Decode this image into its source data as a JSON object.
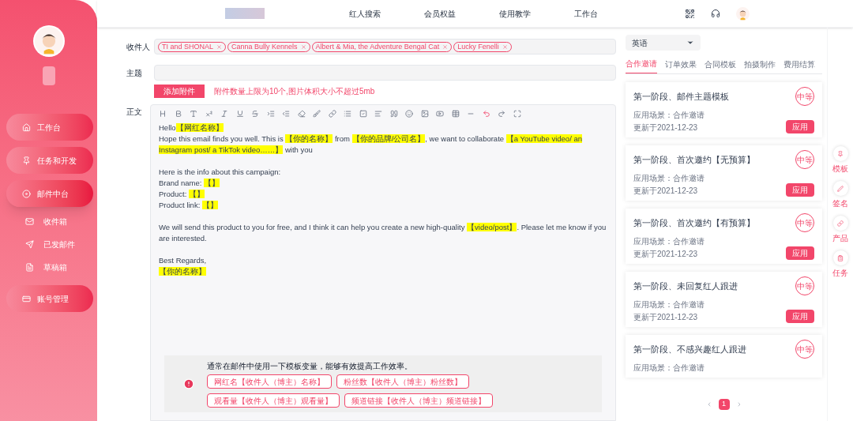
{
  "nav": {
    "items": [
      {
        "label": "红人搜索",
        "selected": false
      },
      {
        "label": "会员权益",
        "selected": false
      },
      {
        "label": "使用教学",
        "selected": false
      },
      {
        "label": "工作台",
        "selected": false
      }
    ]
  },
  "sidebar": {
    "items": [
      {
        "label": "工作台",
        "kind": "main",
        "selected": false
      },
      {
        "label": "任务和开发",
        "kind": "main",
        "selected": false
      },
      {
        "label": "邮件中台",
        "kind": "main",
        "selected": true,
        "expanded": true,
        "children": [
          {
            "label": "收件箱"
          },
          {
            "label": "已发邮件"
          },
          {
            "label": "草稿箱"
          }
        ]
      },
      {
        "label": "账号管理",
        "kind": "main",
        "selected": false
      }
    ]
  },
  "compose": {
    "to_label": "收件人",
    "recipients": [
      "TI and SHONAL",
      "Canna Bully Kennels",
      "Albert & Mia, the Adventure Bengal Cat",
      "Lucky Fenelli"
    ],
    "subject_label": "主题",
    "attach_button": "添加附件",
    "attach_hint": "附件数量上限为10个,图片体积大小不超过5mb",
    "body_label": "正文",
    "body": [
      [
        [
          {
            "text": "Hello",
            "highlight": false
          },
          {
            "text": "【网红名称】",
            "highlight": true
          }
        ],
        [
          {
            "text": "Hope this email finds you well. This is ",
            "highlight": false
          },
          {
            "text": "【你的名称】",
            "highlight": true
          },
          {
            "text": " from ",
            "highlight": false
          },
          {
            "text": "【你的品牌/公司名】",
            "highlight": true
          },
          {
            "text": ", we want to collaborate ",
            "highlight": false
          },
          {
            "text": "【a YouTube video/ an Instagram post/ a TikTok video……】",
            "highlight": true
          },
          {
            "text": " with you",
            "highlight": false
          }
        ]
      ],
      [
        [
          {
            "text": "Here is the info about this campaign:",
            "highlight": false
          }
        ],
        [
          {
            "text": "Brand name: ",
            "highlight": false
          },
          {
            "text": "【】",
            "highlight": true
          }
        ],
        [
          {
            "text": "Product: ",
            "highlight": false
          },
          {
            "text": "【】",
            "highlight": true
          }
        ],
        [
          {
            "text": "Product link: ",
            "highlight": false
          },
          {
            "text": "【】",
            "highlight": true
          }
        ]
      ],
      [
        [
          {
            "text": "We will send this product to you for free, and I think it can help you create a new high-quality ",
            "highlight": false
          },
          {
            "text": "【video/post】",
            "highlight": true
          },
          {
            "text": ". Please let me know if you are interested.",
            "highlight": false
          }
        ]
      ],
      [
        [
          {
            "text": "Best Regards,",
            "highlight": false
          }
        ],
        [
          {
            "text": "【你的名称】",
            "highlight": true
          }
        ]
      ]
    ],
    "tip": "通常在邮件中使用一下模板变量，能够有效提高工作效率。",
    "variables": [
      "网红名【收件人（博主）名称】",
      "粉丝数【收件人（博主）粉丝数】",
      "观看量【收件人（博主）观看量】",
      "频道链接【收件人（博主）频道链接】"
    ]
  },
  "templates": {
    "language": "英语",
    "tabs": [
      {
        "label": "合作邀请",
        "selected": true
      },
      {
        "label": "订单效果",
        "selected": false
      },
      {
        "label": "合同模板",
        "selected": false
      },
      {
        "label": "拍摄制作",
        "selected": false
      },
      {
        "label": "费用结算",
        "selected": false
      }
    ],
    "cards": [
      {
        "title": "第一阶段、邮件主题模板",
        "badge": "中等",
        "scene": "应用场景：合作邀请",
        "updated": "更新于2021-12-23",
        "button": "应用"
      },
      {
        "title": "第一阶段、首次邀约【无预算】",
        "badge": "中等",
        "scene": "应用场景：合作邀请",
        "updated": "更新于2021-12-23",
        "button": "应用"
      },
      {
        "title": "第一阶段、首次邀约【有预算】",
        "badge": "中等",
        "scene": "应用场景：合作邀请",
        "updated": "更新于2021-12-23",
        "button": "应用"
      },
      {
        "title": "第一阶段、未回复红人跟进",
        "badge": "中等",
        "scene": "应用场景：合作邀请",
        "updated": "更新于2021-12-23",
        "button": "应用"
      },
      {
        "title": "第一阶段、不感兴趣红人跟进",
        "badge": "中等",
        "scene": "应用场景：合作邀请"
      }
    ],
    "pages": [
      {
        "label": "1",
        "selected": true
      }
    ]
  },
  "side_tools": [
    {
      "label": "模板",
      "kind": "pin"
    },
    {
      "label": "签名",
      "kind": "pen"
    },
    {
      "label": "产品",
      "kind": "link"
    },
    {
      "label": "任务",
      "kind": "task"
    }
  ]
}
